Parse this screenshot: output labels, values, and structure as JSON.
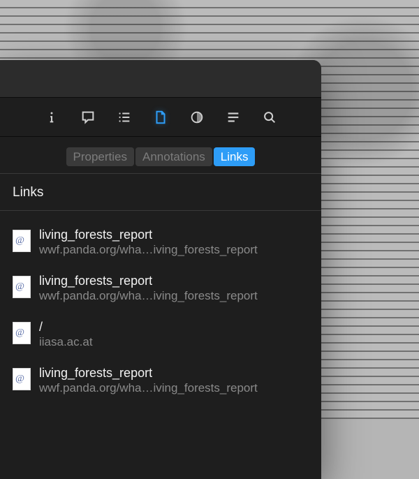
{
  "tabs": {
    "properties": "Properties",
    "annotations": "Annotations",
    "links": "Links"
  },
  "section": {
    "header": "Links"
  },
  "links": [
    {
      "title": "living_forests_report",
      "url": "wwf.panda.org/wha…iving_forests_report"
    },
    {
      "title": "living_forests_report",
      "url": "wwf.panda.org/wha…iving_forests_report"
    },
    {
      "title": "/",
      "url": "iiasa.ac.at"
    },
    {
      "title": "living_forests_report",
      "url": "wwf.panda.org/wha…iving_forests_report"
    }
  ]
}
